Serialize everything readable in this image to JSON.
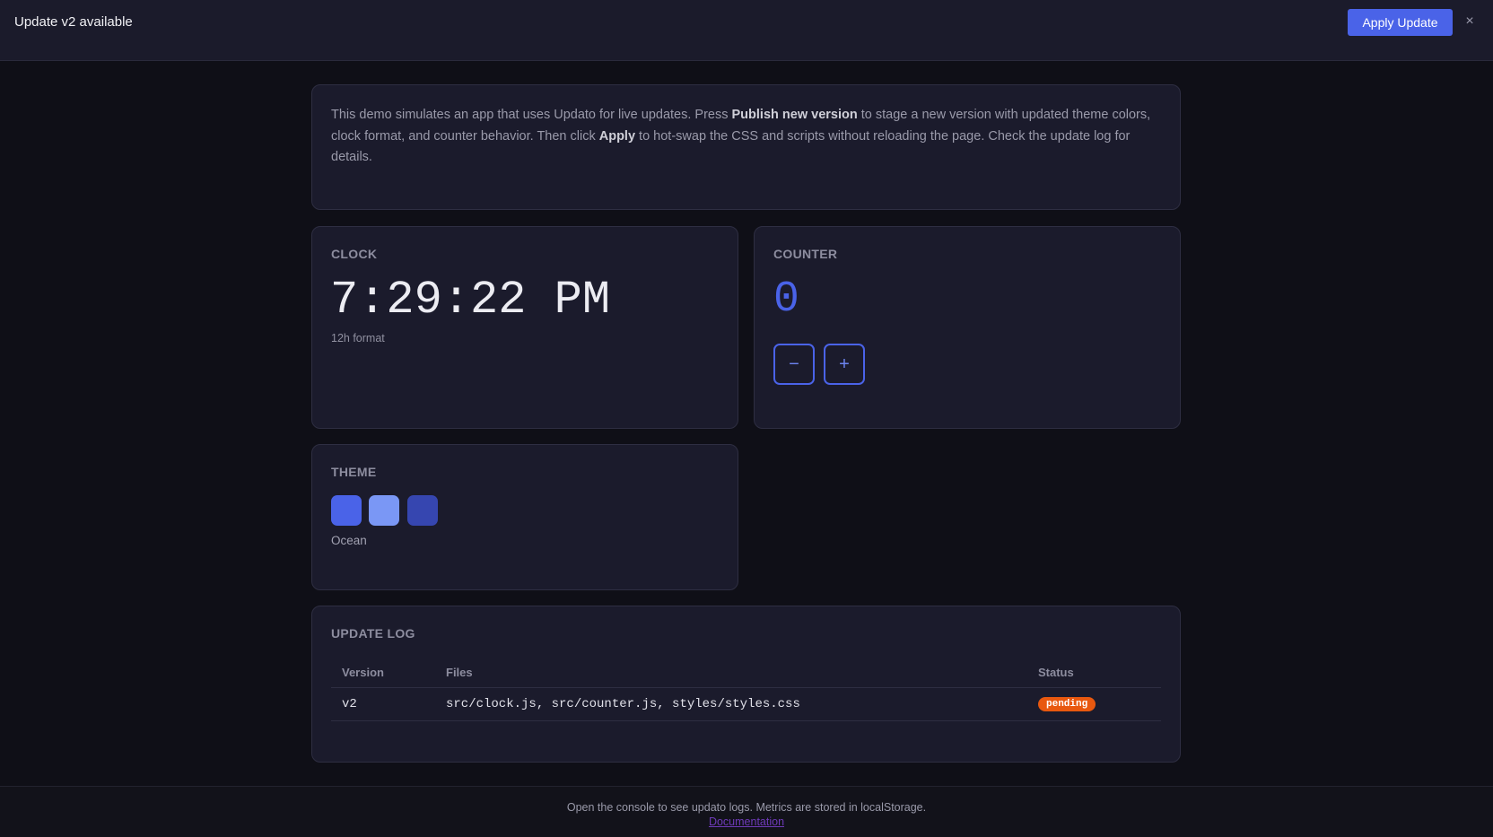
{
  "banner": {
    "title": "Update v2 available",
    "apply_label": "Apply Update",
    "close_glyph": "×"
  },
  "intro": {
    "text_1": "This demo simulates an app that uses Updato for live updates. Press ",
    "bold_1": "Publish new version",
    "text_2": " to stage a new version with updated theme colors, clock format, and counter behavior. Then click ",
    "bold_2": "Apply",
    "text_3": " to hot-swap the CSS and scripts without reloading the page. Check the update log for details."
  },
  "clock": {
    "title": "CLOCK",
    "time": "7:29:22 PM",
    "format": "12h format"
  },
  "counter": {
    "title": "COUNTER",
    "value": "0",
    "decrement_label": "−",
    "increment_label": "+"
  },
  "theme": {
    "title": "THEME",
    "name": "Ocean",
    "swatches": [
      "#4a63e8",
      "#7a97f5",
      "#3646b0"
    ]
  },
  "update_log": {
    "title": "UPDATE LOG",
    "columns": [
      "Version",
      "Files",
      "Status"
    ],
    "rows": [
      {
        "version": "v2",
        "files": "src/clock.js, src/counter.js, styles/styles.css",
        "status": "pending"
      }
    ]
  },
  "footer": {
    "text": "Open the console to see updato logs. Metrics are stored in localStorage.",
    "link_label": "Documentation"
  },
  "colors": {
    "accent": "#4a63e8",
    "pending_badge": "#e8580f",
    "background": "#0f0f17",
    "card": "#1b1b2c"
  }
}
